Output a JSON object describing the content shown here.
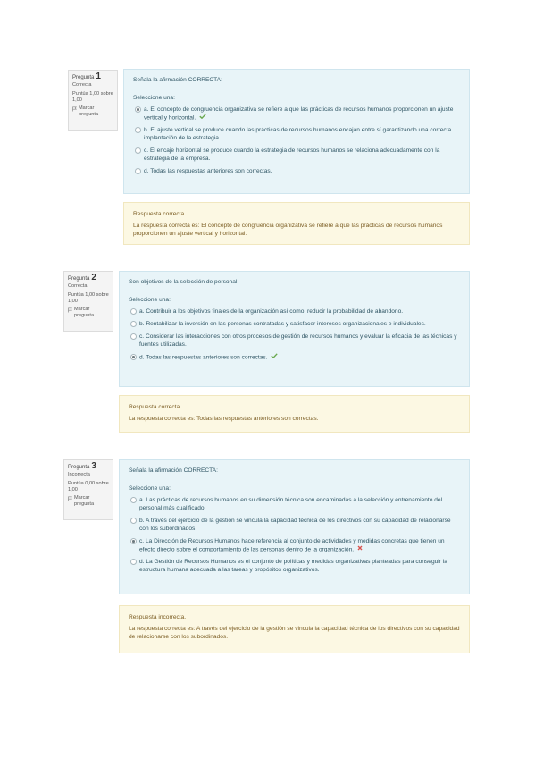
{
  "questions": [
    {
      "title": "Pregunta",
      "number": "1",
      "state": "Correcta",
      "grade": "Puntúa 1,00 sobre 1,00",
      "flag_label": "Marcar pregunta",
      "text": "Señala la afirmación CORRECTA:",
      "prompt": "Seleccione una:",
      "options": [
        {
          "text": "a. El concepto de congruencia organizativa se refiere a que las prácticas de recursos humanos proporcionen un ajuste vertical y horizontal.",
          "selected": true,
          "mark": "correct"
        },
        {
          "text": "b. El ajuste vertical se produce cuando las prácticas de recursos humanos encajan entre sí garantizando una correcta implantación de la estrategia.",
          "selected": false,
          "mark": ""
        },
        {
          "text": "c. El encaje horizontal se produce cuando la estrategia de recursos humanos se relaciona adecuadamente con la estrategia de la empresa.",
          "selected": false,
          "mark": ""
        },
        {
          "text": "d. Todas las respuestas anteriores son correctas.",
          "selected": false,
          "mark": ""
        }
      ],
      "feedback_title": "Respuesta correcta",
      "feedback_text": "La respuesta correcta es: El concepto de congruencia organizativa se refiere a que las prácticas de recursos humanos proporcionen un ajuste vertical y horizontal."
    },
    {
      "title": "Pregunta",
      "number": "2",
      "state": "Correcta",
      "grade": "Puntúa 1,00 sobre 1,00",
      "flag_label": "Marcar pregunta",
      "text": "Son objetivos de la selección de personal:",
      "prompt": "Seleccione una:",
      "options": [
        {
          "text": "a. Contribuir a los objetivos finales de la organización así como, reducir la probabilidad de abandono.",
          "selected": false,
          "mark": ""
        },
        {
          "text": "b. Rentabilizar la inversión en las personas contratadas y satisfacer intereses organizacionales e individuales.",
          "selected": false,
          "mark": ""
        },
        {
          "text": "c. Considerar las interacciones con otros procesos de gestión de recursos humanos y evaluar la eficacia de las técnicas y fuentes utilizadas.",
          "selected": false,
          "mark": ""
        },
        {
          "text": "d. Todas las respuestas anteriores son correctas.",
          "selected": true,
          "mark": "correct"
        }
      ],
      "feedback_title": "Respuesta correcta",
      "feedback_text": "La respuesta correcta es: Todas las respuestas anteriores son correctas."
    },
    {
      "title": "Pregunta",
      "number": "3",
      "state": "Incorrecta",
      "grade": "Puntúa 0,00 sobre 1,00",
      "flag_label": "Marcar pregunta",
      "text": "Señala la afirmación CORRECTA:",
      "prompt": "Seleccione una:",
      "options": [
        {
          "text": "a. Las prácticas de recursos humanos en su dimensión técnica son encaminadas a la selección y entrenamiento del personal más cualificado.",
          "selected": false,
          "mark": ""
        },
        {
          "text": "b. A través del ejercicio de la gestión se vincula la capacidad técnica de los directivos con su capacidad de relacionarse con los subordinados.",
          "selected": false,
          "mark": ""
        },
        {
          "text": "c. La Dirección de Recursos Humanos hace referencia al conjunto de actividades y medidas concretas que tienen un efecto directo sobre el comportamiento de las personas dentro de la organización.",
          "selected": true,
          "mark": "incorrect"
        },
        {
          "text": "d. La Gestión de Recursos Humanos es el conjunto de políticas y medidas organizativas planteadas para conseguir la estructura humana adecuada a las tareas y propósitos organizativos.",
          "selected": false,
          "mark": ""
        }
      ],
      "feedback_title": "Respuesta incorrecta.",
      "feedback_text": "La respuesta correcta es: A través del ejercicio de la gestión se vincula la capacidad técnica de los directivos con su capacidad de relacionarse con los subordinados."
    }
  ],
  "colors": {
    "formulation_bg": "#e8f4f8",
    "feedback_bg": "#fcf8e3",
    "info_bg": "#f4f4f4",
    "correct": "#6aa84f",
    "incorrect": "#d9534f"
  }
}
